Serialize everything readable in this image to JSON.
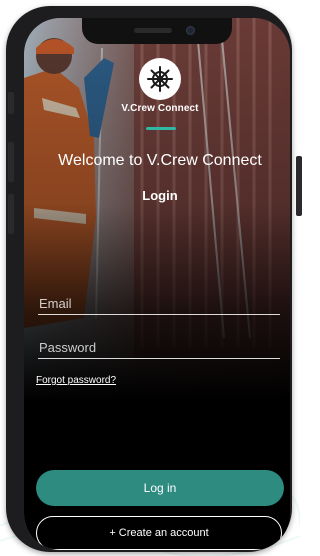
{
  "app": {
    "brand_name": "V.Crew Connect",
    "welcome_text": "Welcome to V.Crew Connect",
    "screen_title": "Login",
    "logo_icon": "ship-wheel-icon"
  },
  "form": {
    "email_placeholder": "Email",
    "password_placeholder": "Password",
    "forgot_password_label": "Forgot password?"
  },
  "actions": {
    "login_label": "Log in",
    "create_account_label": "+ Create an account"
  },
  "colors": {
    "accent": "#2fb8a3",
    "login_button": "#2d8b80",
    "phone_frame": "#1d1d1f"
  }
}
